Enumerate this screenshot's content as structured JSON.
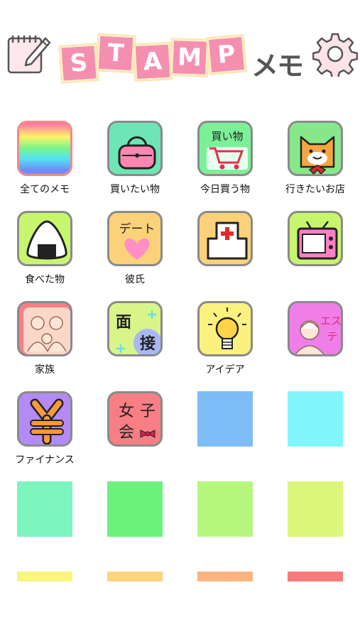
{
  "app": {
    "logo_letters": [
      "S",
      "T",
      "A",
      "M",
      "P"
    ],
    "logo_suffix": "メモ"
  },
  "icons": {
    "memo": "notepad-pencil-icon",
    "settings": "gear-icon"
  },
  "categories": [
    {
      "label": "全てのメモ",
      "icon": "rainbow-icon"
    },
    {
      "label": "買いたい物",
      "icon": "handbag-icon"
    },
    {
      "label": "今日買う物",
      "icon": "shopping-cart-icon",
      "icon_text": "買い物"
    },
    {
      "label": "行きたいお店",
      "icon": "cat-face-icon"
    },
    {
      "label": "食べた物",
      "icon": "rice-ball-icon"
    },
    {
      "label": "彼氏",
      "icon": "heart-date-icon",
      "icon_text": "デート"
    },
    {
      "label": "",
      "icon": "hospital-icon"
    },
    {
      "label": "",
      "icon": "television-icon"
    },
    {
      "label": "家族",
      "icon": "family-icon"
    },
    {
      "label": "",
      "icon": "interview-icon",
      "icon_text": "面接"
    },
    {
      "label": "アイデア",
      "icon": "lightbulb-icon"
    },
    {
      "label": "",
      "icon": "beauty-salon-icon",
      "icon_text": "エステ"
    },
    {
      "label": "ファイナンス",
      "icon": "yen-icon"
    },
    {
      "label": "",
      "icon": "girls-party-icon",
      "icon_text": "女子会"
    }
  ],
  "empty_slot_colors": [
    "#7dbcf7",
    "#80f6fb",
    "#7cf5be",
    "#6cf27c",
    "#b4f77c",
    "#dbf779"
  ],
  "partial_slot_colors": [
    "#faf57d",
    "#fbd47d",
    "#fbb380",
    "#f97a7a"
  ]
}
